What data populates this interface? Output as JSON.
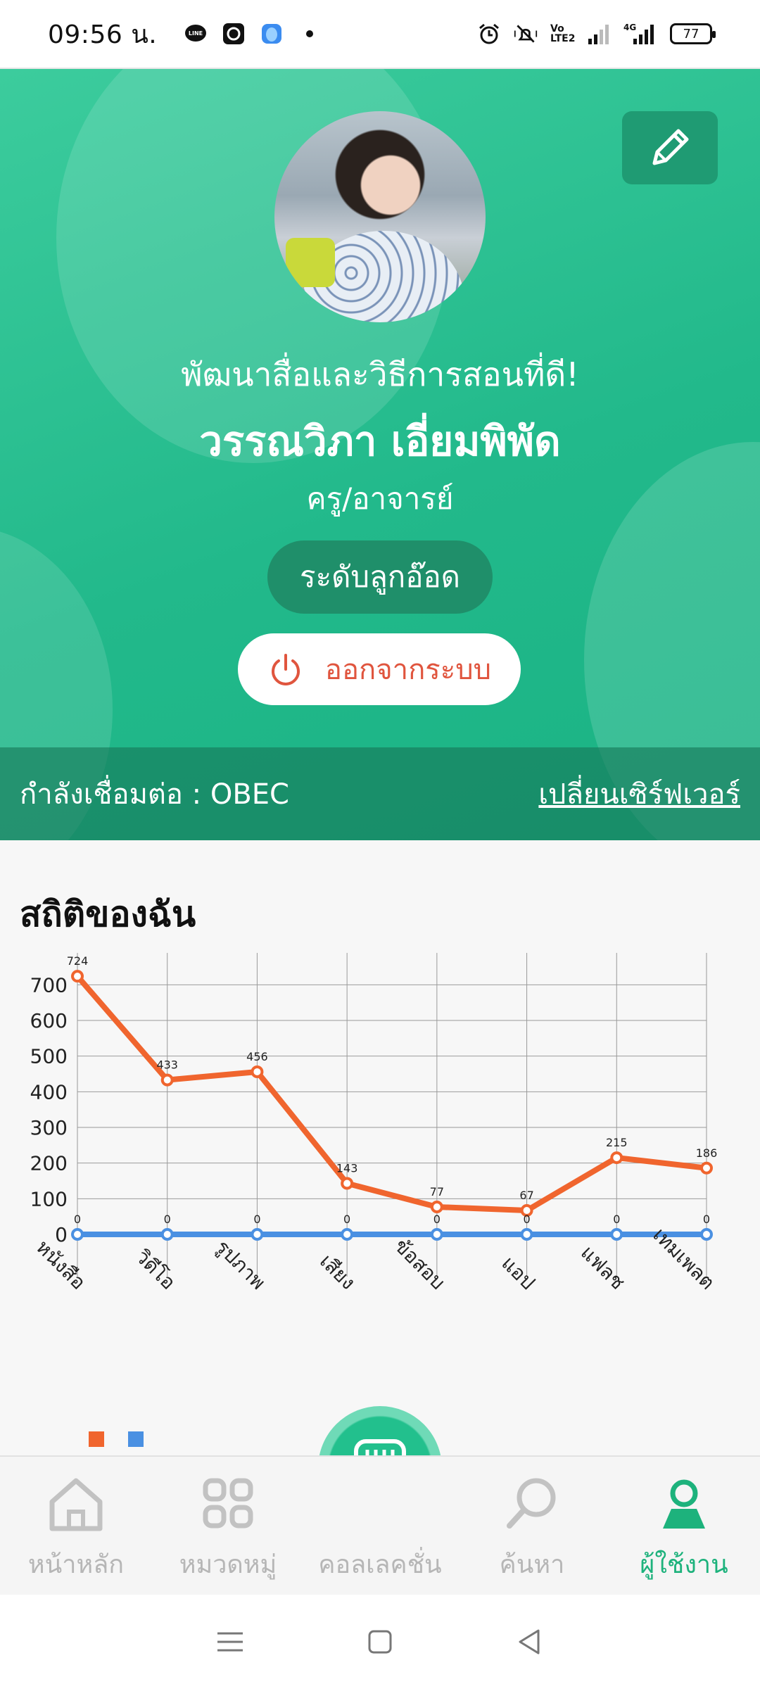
{
  "status_bar": {
    "time": "09:56 น.",
    "battery": "77",
    "network": "4G",
    "volte": "Vo LTE2"
  },
  "profile": {
    "slogan": "พัฒนาสื่อและวิธีการสอนที่ดี!",
    "name": "วรรณวิภา เอี่ยมพิพัด",
    "role": "ครู/อาจารย์",
    "level": "ระดับลูกอ๊อด",
    "logout_label": "ออกจากระบบ"
  },
  "server": {
    "status_label": "กำลังเชื่อมต่อ : OBEC",
    "change_label": "เปลี่ยนเซิร์ฟเวอร์"
  },
  "stats": {
    "title": "สถิติของฉัน"
  },
  "chart_data": {
    "type": "line",
    "categories": [
      "หนังสือ",
      "วิดีโอ",
      "รูปภาพ",
      "เสียง",
      "ข้อสอบ",
      "แอป",
      "แฟลช",
      "เทมเพลต"
    ],
    "series": [
      {
        "values": [
          724,
          433,
          456,
          143,
          77,
          67,
          215,
          186
        ],
        "color": "#f0652e"
      },
      {
        "values": [
          0,
          0,
          0,
          0,
          0,
          0,
          0,
          0
        ],
        "color": "#4a90e2"
      }
    ],
    "yticks": [
      0,
      100,
      200,
      300,
      400,
      500,
      600,
      700
    ],
    "ylim": [
      0,
      750
    ],
    "grid": true,
    "legend_position": "bottom-left"
  },
  "nav": {
    "items": [
      {
        "label": "หน้าหลัก",
        "icon": "home-icon"
      },
      {
        "label": "หมวดหมู่",
        "icon": "category-icon"
      },
      {
        "label": "คอลเลคชั่น",
        "icon": "collection-icon"
      },
      {
        "label": "ค้นหา",
        "icon": "search-icon"
      },
      {
        "label": "ผู้ใช้งาน",
        "icon": "user-icon"
      }
    ],
    "active_color": "#1db27c",
    "inactive_color": "#b6b6b6"
  }
}
